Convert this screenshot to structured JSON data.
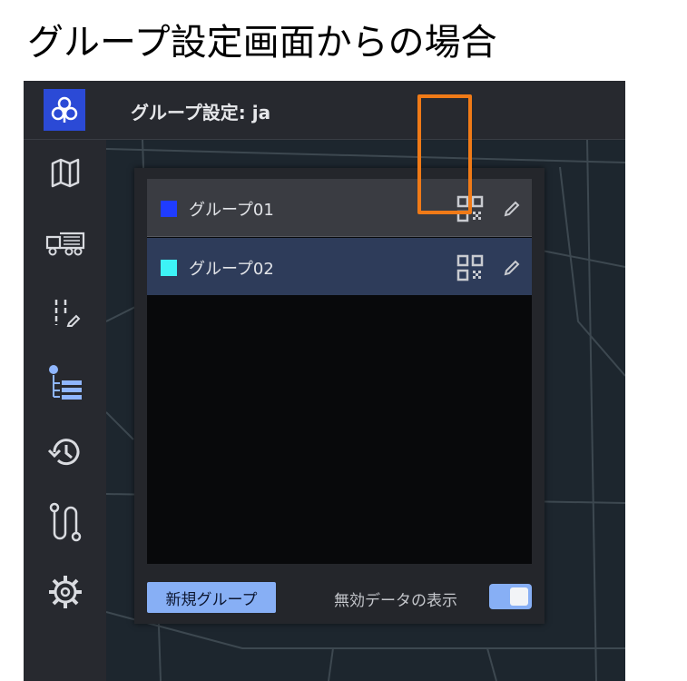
{
  "caption": "グループ設定画面からの場合",
  "header": {
    "title": "グループ設定: ja",
    "logo_icon": "location-share-icon"
  },
  "sidebar": {
    "items": [
      {
        "name": "map",
        "icon": "map-icon"
      },
      {
        "name": "vehicles",
        "icon": "truck-icon"
      },
      {
        "name": "edit-list",
        "icon": "list-edit-icon"
      },
      {
        "name": "groups",
        "icon": "group-list-icon",
        "active": true
      },
      {
        "name": "history",
        "icon": "history-icon"
      },
      {
        "name": "route",
        "icon": "route-icon"
      },
      {
        "name": "settings",
        "icon": "gear-icon"
      }
    ],
    "active_color": "#8fb6ff"
  },
  "groups": {
    "items": [
      {
        "label": "グループ01",
        "color": "#1f3cff"
      },
      {
        "label": "グループ02",
        "color": "#3df3f6"
      }
    ],
    "new_button": "新規グループ",
    "toggle_label": "無効データの表示",
    "toggle_on": true
  },
  "colors": {
    "accent": "#87aff5",
    "highlight": "#f07a17"
  }
}
